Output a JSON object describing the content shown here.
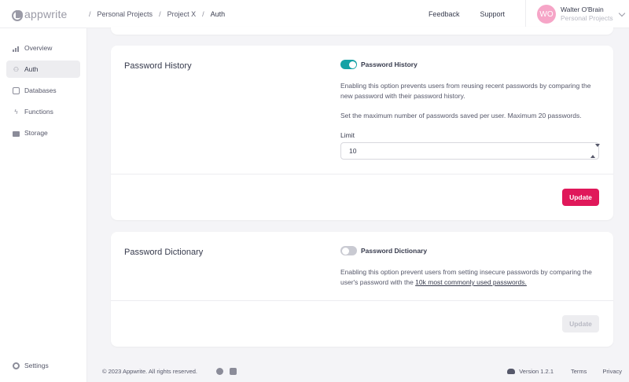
{
  "header": {
    "logo_text": "appwrite",
    "breadcrumbs": [
      "Personal Projects",
      "Project X",
      "Auth"
    ],
    "feedback": "Feedback",
    "support": "Support",
    "user": {
      "initials": "WO",
      "name": "Walter O'Brain",
      "org": "Personal Projects"
    }
  },
  "sidebar": {
    "items": [
      {
        "label": "Overview",
        "icon": "bar-chart-icon"
      },
      {
        "label": "Auth",
        "icon": "users-icon"
      },
      {
        "label": "Databases",
        "icon": "database-icon"
      },
      {
        "label": "Functions",
        "icon": "lightning-icon"
      },
      {
        "label": "Storage",
        "icon": "folder-icon"
      }
    ],
    "active": "Auth",
    "settings": "Settings"
  },
  "password_history": {
    "title": "Password History",
    "toggle_label": "Password History",
    "toggle_on": true,
    "desc1": "Enabling this option prevents users from reusing recent passwords by comparing the new password with their password history.",
    "desc2": "Set the maximum number of passwords saved per user. Maximum 20 passwords.",
    "limit_label": "Limit",
    "limit_value": "10",
    "update_label": "Update"
  },
  "password_dictionary": {
    "title": "Password Dictionary",
    "toggle_label": "Password Dictionary",
    "toggle_on": false,
    "desc_before": "Enabling this option prevent users from setting insecure passwords by comparing the user's password with the ",
    "desc_link": "10k most commonly used passwords.",
    "update_label": "Update"
  },
  "footer": {
    "copyright": "© 2023 Appwrite. All rights reserved.",
    "version": "Version 1.2.1",
    "terms": "Terms",
    "privacy": "Privacy"
  },
  "colors": {
    "accent": "#e0185a",
    "toggle_on": "#14a2a5",
    "avatar": "#f6a5c7"
  }
}
